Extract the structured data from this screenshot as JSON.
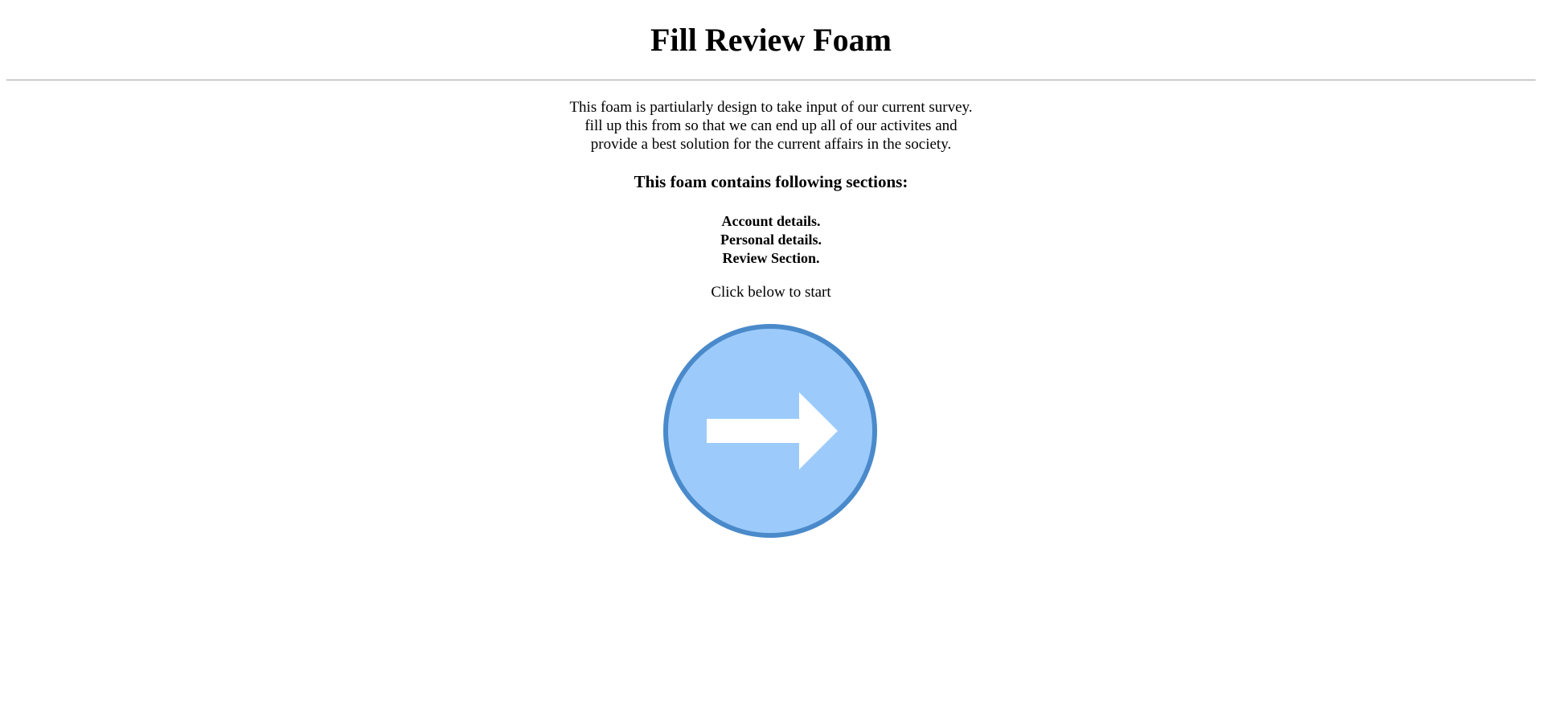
{
  "page": {
    "title": "Fill Review Foam"
  },
  "intro": {
    "lines": [
      "This foam is partiularly design to take input of our current survey.",
      "fill up this from so that we can end up all of our activites and",
      "provide a best solution for the current affairs in the society."
    ]
  },
  "sections": {
    "heading": "This foam contains following sections:",
    "items": [
      "Account details.",
      "Personal details.",
      "Review Section."
    ]
  },
  "start": {
    "hint": "Click below to start",
    "button_icon": "arrow-right-circle-icon"
  },
  "colors": {
    "button_fill": "#9ccbfb",
    "button_border": "#4a8acb",
    "arrow": "#ffffff",
    "divider": "#a0a0a0"
  }
}
